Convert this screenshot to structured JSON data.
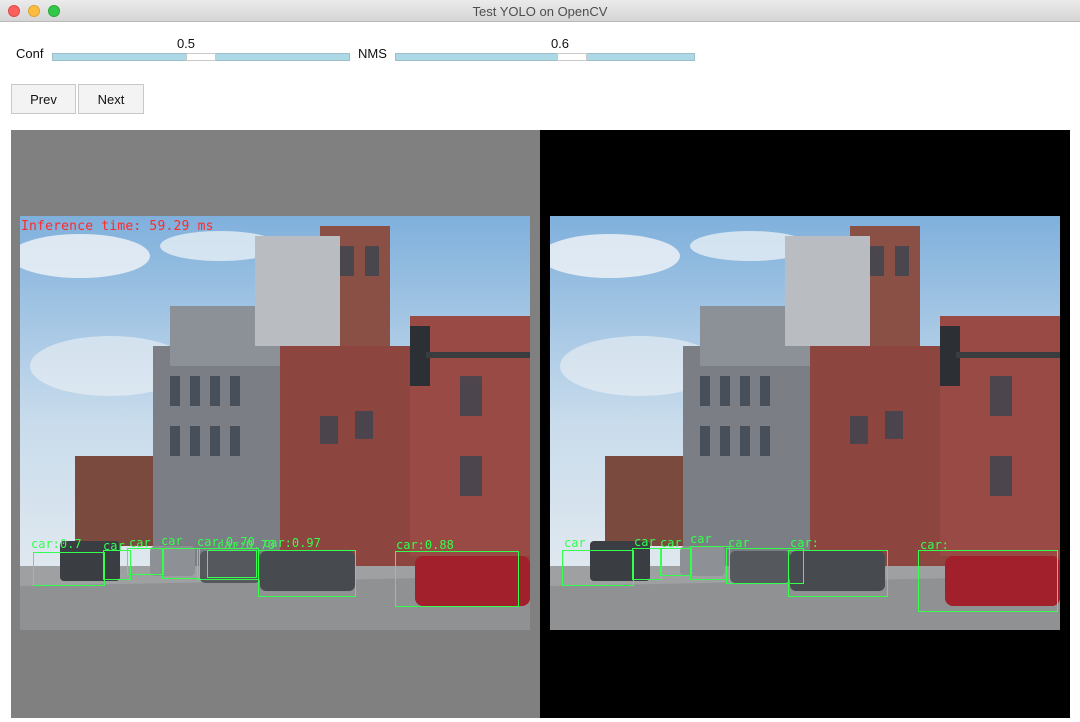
{
  "window": {
    "title": "Test YOLO on OpenCV"
  },
  "controls": {
    "conf_label": "Conf",
    "conf_value": "0.5",
    "conf_level": 0.5,
    "nms_label": "NMS",
    "nms_value": "0.6",
    "nms_level": 0.6,
    "prev_label": "Prev",
    "next_label": "Next"
  },
  "left_view": {
    "inference_text": "Inference time: 59.29 ms",
    "labels": [
      "car:0.7",
      "car",
      "car",
      "car",
      "car:0.70",
      "car:0.70",
      "car:0.97",
      "car:0.88"
    ]
  },
  "right_view": {
    "labels": [
      "car",
      "car",
      "car",
      "car",
      "car",
      "car:",
      "car:",
      "car:"
    ]
  },
  "colors": {
    "slider_fill": "#add8e6",
    "left_background": "#808080",
    "right_background": "#000000",
    "detection_box": "#33ff4d",
    "inference_text": "#ff2a2a"
  }
}
